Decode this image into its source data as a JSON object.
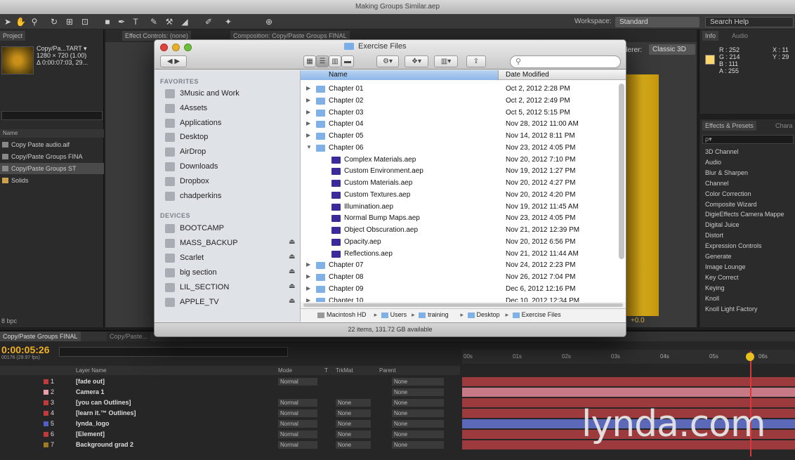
{
  "app": {
    "title": "Making Groups Similar.aep",
    "workspace_label": "Workspace:",
    "workspace_value": "Standard",
    "search_help": "Search Help"
  },
  "project": {
    "tab": "Project",
    "comp_name": "Copy/Pa...TART ▾",
    "comp_size": "1280 × 720 (1.00)",
    "comp_duration": "Δ 0:00:07:03, 29...",
    "header_name": "Name",
    "items": [
      {
        "label": "Copy Paste audio.aif"
      },
      {
        "label": "Copy/Paste Groups FINA"
      },
      {
        "label": "Copy/Paste Groups ST"
      },
      {
        "label": "Solids"
      }
    ],
    "footer_bpc": "8 bpc"
  },
  "composition": {
    "tab_effects": "Effect Controls: (none)",
    "tab_comp": "Composition: Copy/Paste Groups FINAL",
    "renderer_label": "derer:",
    "renderer_value": "Classic 3D",
    "zoom_value": "+0.0"
  },
  "info": {
    "tab_info": "Info",
    "tab_audio": "Audio",
    "r": "R : 252",
    "g": "G : 214",
    "b": "B : 111",
    "a": "A : 255",
    "x": "X : 11",
    "y": "Y : 29",
    "swatch_color": "#fcd66f"
  },
  "effects": {
    "tab": "Effects & Presets",
    "tab2": "Chara",
    "search_placeholder": "ρ▾",
    "items": [
      "3D Channel",
      "Audio",
      "Blur & Sharpen",
      "Channel",
      "Color Correction",
      "Composite Wizard",
      "DigieEffects Camera Mappe",
      "Digital Juice",
      "Distort",
      "Expression Controls",
      "Generate",
      "Image Lounge",
      "Key Correct",
      "Keying",
      "Knoll",
      "Knoll Light Factory"
    ]
  },
  "timeline": {
    "tab_final": "Copy/Paste Groups FINAL",
    "tab_start": "Copy/Paste...",
    "timecode": "0:00:05:26",
    "fps": "00176 (29.97 fps)",
    "headers": {
      "layer_name": "Layer Name",
      "mode": "Mode",
      "t": "T",
      "trkmat": "TrkMat",
      "parent": "Parent"
    },
    "ruler": [
      "00s",
      "01s",
      "02s",
      "03s",
      "04s",
      "05s",
      "06s"
    ],
    "layers": [
      {
        "num": "1",
        "name": "[fade out]",
        "mode": "Normal",
        "trk": "",
        "parent": "None",
        "color": "#c23b3b"
      },
      {
        "num": "2",
        "name": "Camera 1",
        "mode": "",
        "trk": "",
        "parent": "None",
        "color": "#e7a0a8"
      },
      {
        "num": "3",
        "name": "[you can Outlines]",
        "mode": "Normal",
        "trk": "None",
        "parent": "None",
        "color": "#c23b3b"
      },
      {
        "num": "4",
        "name": "[learn it.™ Outlines]",
        "mode": "Normal",
        "trk": "None",
        "parent": "None",
        "color": "#c23b3b"
      },
      {
        "num": "5",
        "name": "lynda_logo",
        "mode": "Normal",
        "trk": "None",
        "parent": "None",
        "color": "#5060c8"
      },
      {
        "num": "6",
        "name": "[Element]",
        "mode": "Normal",
        "trk": "None",
        "parent": "None",
        "color": "#c23b3b"
      },
      {
        "num": "7",
        "name": "Background grad 2",
        "mode": "Normal",
        "trk": "None",
        "parent": "None",
        "color": "#a07a20"
      }
    ],
    "watermark": "lynda.com"
  },
  "finder": {
    "title": "Exercise Files",
    "sidebar": {
      "favorites_label": "FAVORITES",
      "favorites": [
        {
          "label": "3Music and Work",
          "icon": "folder-icon"
        },
        {
          "label": "4Assets",
          "icon": "folder-icon"
        },
        {
          "label": "Applications",
          "icon": "applications-icon"
        },
        {
          "label": "Desktop",
          "icon": "desktop-icon"
        },
        {
          "label": "AirDrop",
          "icon": "airdrop-icon"
        },
        {
          "label": "Downloads",
          "icon": "downloads-icon"
        },
        {
          "label": "Dropbox",
          "icon": "dropbox-icon"
        },
        {
          "label": "chadperkins",
          "icon": "home-icon"
        }
      ],
      "devices_label": "DEVICES",
      "devices": [
        {
          "label": "BOOTCAMP",
          "eject": ""
        },
        {
          "label": "MASS_BACKUP",
          "eject": "⏏"
        },
        {
          "label": "Scarlet",
          "eject": "⏏"
        },
        {
          "label": "big section",
          "eject": "⏏"
        },
        {
          "label": "LIL_SECTION",
          "eject": "⏏"
        },
        {
          "label": "APPLE_TV",
          "eject": "⏏"
        }
      ]
    },
    "columns": {
      "name": "Name",
      "date": "Date Modified"
    },
    "rows": [
      {
        "name": "Chapter 01",
        "date": "Oct 2, 2012 2:28 PM",
        "type": "folder",
        "indent": 0,
        "tri": "▶"
      },
      {
        "name": "Chapter 02",
        "date": "Oct 2, 2012 2:49 PM",
        "type": "folder",
        "indent": 0,
        "tri": "▶"
      },
      {
        "name": "Chapter 03",
        "date": "Oct 5, 2012 5:15 PM",
        "type": "folder",
        "indent": 0,
        "tri": "▶"
      },
      {
        "name": "Chapter 04",
        "date": "Nov 28, 2012 11:00 AM",
        "type": "folder",
        "indent": 0,
        "tri": "▶"
      },
      {
        "name": "Chapter 05",
        "date": "Nov 14, 2012 8:11 PM",
        "type": "folder",
        "indent": 0,
        "tri": "▶"
      },
      {
        "name": "Chapter 06",
        "date": "Nov 23, 2012 4:05 PM",
        "type": "folder",
        "indent": 0,
        "tri": "▼"
      },
      {
        "name": "Complex Materials.aep",
        "date": "Nov 20, 2012 7:10 PM",
        "type": "aep",
        "indent": 1,
        "tri": ""
      },
      {
        "name": "Custom Environment.aep",
        "date": "Nov 19, 2012 1:27 PM",
        "type": "aep",
        "indent": 1,
        "tri": ""
      },
      {
        "name": "Custom Materials.aep",
        "date": "Nov 20, 2012 4:27 PM",
        "type": "aep",
        "indent": 1,
        "tri": ""
      },
      {
        "name": "Custom Textures.aep",
        "date": "Nov 20, 2012 4:20 PM",
        "type": "aep",
        "indent": 1,
        "tri": ""
      },
      {
        "name": "Illumination.aep",
        "date": "Nov 19, 2012 11:45 AM",
        "type": "aep",
        "indent": 1,
        "tri": ""
      },
      {
        "name": "Normal Bump Maps.aep",
        "date": "Nov 23, 2012 4:05 PM",
        "type": "aep",
        "indent": 1,
        "tri": ""
      },
      {
        "name": "Object Obscuration.aep",
        "date": "Nov 21, 2012 12:39 PM",
        "type": "aep",
        "indent": 1,
        "tri": ""
      },
      {
        "name": "Opacity.aep",
        "date": "Nov 20, 2012 6:56 PM",
        "type": "aep",
        "indent": 1,
        "tri": ""
      },
      {
        "name": "Reflections.aep",
        "date": "Nov 21, 2012 11:44 AM",
        "type": "aep",
        "indent": 1,
        "tri": ""
      },
      {
        "name": "Chapter 07",
        "date": "Nov 24, 2012 2:23 PM",
        "type": "folder",
        "indent": 0,
        "tri": "▶"
      },
      {
        "name": "Chapter 08",
        "date": "Nov 26, 2012 7:04 PM",
        "type": "folder",
        "indent": 0,
        "tri": "▶"
      },
      {
        "name": "Chapter 09",
        "date": "Dec 6, 2012 12:16 PM",
        "type": "folder",
        "indent": 0,
        "tri": "▶"
      },
      {
        "name": "Chapter 10",
        "date": "Dec 10, 2012 12:34 PM",
        "type": "folder",
        "indent": 0,
        "tri": "▶"
      }
    ],
    "path": [
      "Macintosh HD",
      "Users",
      "training",
      "Desktop",
      "Exercise Files"
    ],
    "status": "22 items, 131.72 GB available"
  }
}
